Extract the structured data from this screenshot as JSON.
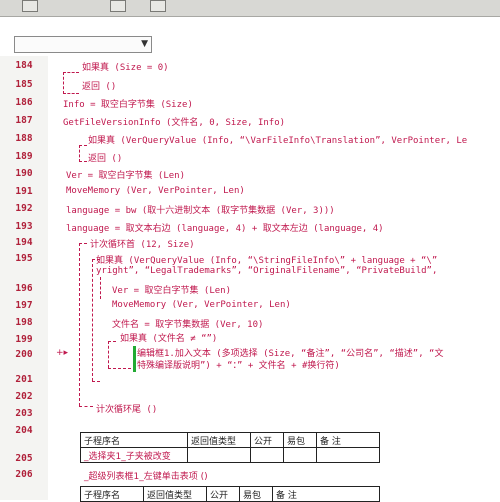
{
  "toolbar": {
    "buttons": [
      "btn-1",
      "btn-2",
      "btn-3"
    ]
  },
  "dropdown": {
    "value": ""
  },
  "lines": [
    {
      "n": "184",
      "t": "如果真 (Size = 0)"
    },
    {
      "n": "185",
      "t": "返回 ()"
    },
    {
      "n": "186",
      "t": "Info = 取空白字节集 (Size)"
    },
    {
      "n": "187",
      "t": "GetFileVersionInfo (文件名, 0, Size, Info)"
    },
    {
      "n": "188",
      "t": "如果真 (VerQueryValue (Info, “\\VarFileInfo\\Translation”, VerPointer, Le"
    },
    {
      "n": "189",
      "t": "返回 ()"
    },
    {
      "n": "190",
      "t": "Ver = 取空白字节集 (Len)"
    },
    {
      "n": "191",
      "t": "MoveMemory (Ver, VerPointer, Len)"
    },
    {
      "n": "192",
      "t": "language = bw (取十六进制文本 (取字节集数据 (Ver, 3)))"
    },
    {
      "n": "193",
      "t": "language = 取文本右边 (language, 4) + 取文本左边 (language, 4)"
    },
    {
      "n": "194",
      "t": "计次循环首 (12, Size)"
    },
    {
      "n": "195",
      "t": "如果真 (VerQueryValue (Info, “\\StringFileInfo\\” + language + “\\”"
    },
    {
      "n": "",
      "t": "yright”, “LegalTrademarks”, “OriginalFilename”, “PrivateBuild”,"
    },
    {
      "n": "196",
      "t": "Ver = 取空白字节集 (Len)"
    },
    {
      "n": "197",
      "t": "MoveMemory (Ver, VerPointer, Len)"
    },
    {
      "n": "198",
      "t": "文件名 = 取字节集数据 (Ver, 10)"
    },
    {
      "n": "199",
      "t": "如果真 (文件名 ≠ “”)"
    },
    {
      "n": "200",
      "t": "编辑框1.加入文本 (多项选择 (Size, “备注”, “公司名”, “描述”, “文"
    },
    {
      "n": "",
      "t": "特殊编译版说明”) + “：” + 文件名 + #换行符)"
    },
    {
      "n": "201",
      "t": ""
    },
    {
      "n": "202",
      "t": ""
    },
    {
      "n": "203",
      "t": "计次循环尾 ()"
    },
    {
      "n": "204",
      "t": ""
    }
  ],
  "table1": {
    "headers": [
      "子程序名",
      "返回值类型",
      "公开",
      "易包",
      "备 注"
    ],
    "row": "_选择夹1_子夹被改变"
  },
  "line205": "205",
  "line206": "206",
  "sub2": "_超级列表框1_左键单击表项 ()",
  "table2": {
    "headers": [
      "子程序名",
      "返回值类型",
      "公开",
      "易包",
      "备 注"
    ]
  },
  "marker200": "+▸"
}
